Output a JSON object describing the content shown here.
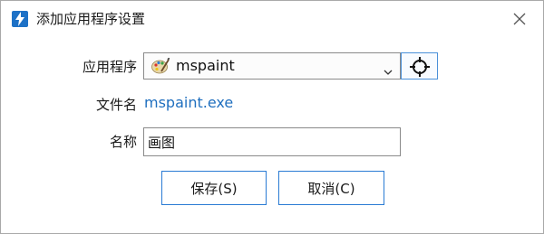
{
  "window": {
    "title": "添加应用程序设置"
  },
  "form": {
    "app_label": "应用程序",
    "app_value": "mspaint",
    "app_icon": "paint-palette-icon",
    "file_label": "文件名",
    "file_value": "mspaint.exe",
    "name_label": "名称",
    "name_value": "画图"
  },
  "buttons": {
    "save_label": "保存(S)",
    "cancel_label": "取消(C)"
  },
  "colors": {
    "accent": "#2a7bd4",
    "link": "#1f6fbf",
    "app_icon_bg": "#1d71c6"
  }
}
